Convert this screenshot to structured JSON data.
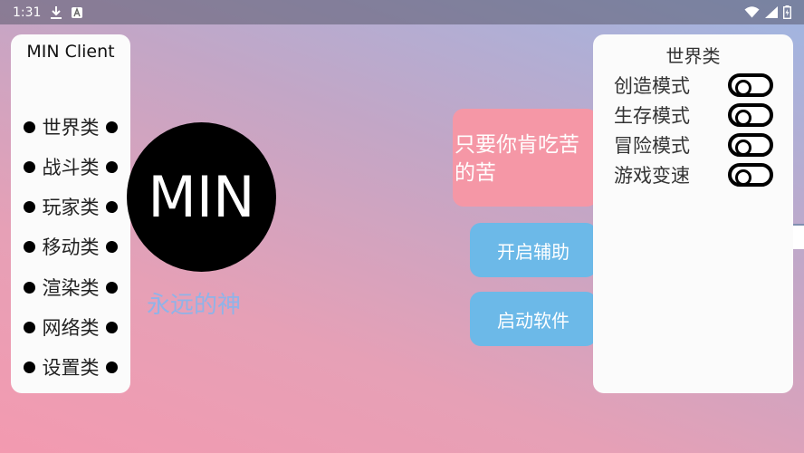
{
  "status_bar": {
    "time": "1:31",
    "left_icons": [
      "download-icon",
      "app-notification-icon"
    ],
    "right_icons": [
      "wifi-icon",
      "signal-icon",
      "battery-icon"
    ]
  },
  "menu": {
    "title": "MIN Client",
    "items": [
      {
        "label": "世界类"
      },
      {
        "label": "战斗类"
      },
      {
        "label": "玩家类"
      },
      {
        "label": "移动类"
      },
      {
        "label": "渲染类"
      },
      {
        "label": "网络类"
      },
      {
        "label": "设置类"
      }
    ]
  },
  "logo": {
    "text": "MIN"
  },
  "subtitle": "永远的神",
  "slogan": "只要你肯吃苦的苦",
  "buttons": {
    "enable_assist": "开启辅助",
    "launch_software": "启动软件"
  },
  "panel": {
    "title": "世界类",
    "toggles": [
      {
        "label": "创造模式",
        "on": false
      },
      {
        "label": "生存模式",
        "on": false
      },
      {
        "label": "冒险模式",
        "on": false
      },
      {
        "label": "游戏变速",
        "on": false
      }
    ]
  },
  "colors": {
    "menu_bg": "#fbfbfb",
    "slogan_bg": "#f597a6",
    "button_bg": "#6cb9e8",
    "subtitle": "#8fb3e8",
    "logo_bg": "#000000"
  }
}
